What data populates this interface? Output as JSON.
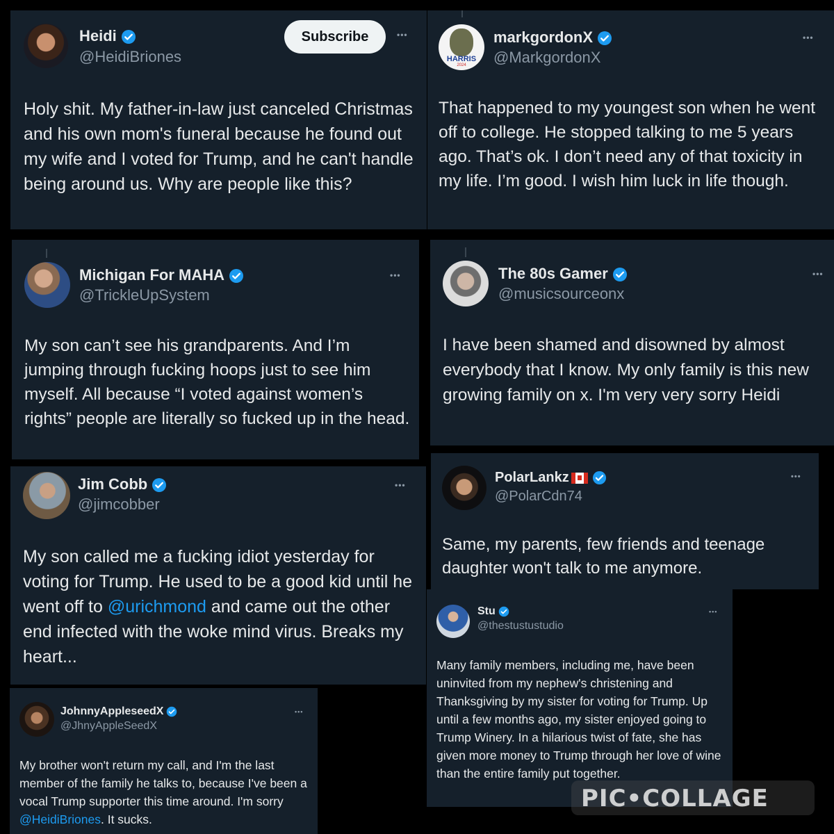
{
  "colors": {
    "background": "#000000",
    "card": "#15202b",
    "text": "#e7e9ea",
    "muted": "#8b98a5",
    "link": "#1d9bf0",
    "verified": "#1d9bf0"
  },
  "icons": {
    "verified": "verified-badge-icon",
    "more": "more-dots-icon",
    "flag": "canada-flag-icon"
  },
  "posts": [
    {
      "name": "Heidi",
      "handle": "@HeidiBriones",
      "subscribe_label": "Subscribe",
      "more": "•••",
      "text": "Holy shit. My father-in-law just canceled Christmas and his own mom's funeral because he found out my wife and I voted for Trump, and he can't handle being around us. Why are people like this?"
    },
    {
      "name": "markgordonX",
      "handle": "@MarkgordonX",
      "avatar_text": "HARRIS",
      "avatar_sub": "2024",
      "more": "•••",
      "text": "That happened to my youngest son when he went off to college. He stopped talking to me 5 years ago. That’s ok. I don’t need any of that toxicity in my life. I’m good. I wish him luck in life though."
    },
    {
      "name": "Michigan For MAHA",
      "handle": "@TrickleUpSystem",
      "more": "•••",
      "text": "My son can’t see his grandparents. And I’m jumping through fucking hoops just to see him myself. All because “I voted against women’s rights” people are literally so fucked up in the head."
    },
    {
      "name": "The 80s Gamer",
      "handle": "@musicsourceonx",
      "more": "•••",
      "text": "I have been shamed and disowned by almost everybody that I know. My only family is this new growing family on x. I'm very very sorry Heidi"
    },
    {
      "name": "Jim Cobb",
      "handle": "@jimcobber",
      "more": "•••",
      "text_before": "My son called me a fucking idiot yesterday for voting for Trump. He used to be a good kid until he went off to ",
      "mention": "@urichmond",
      "text_after": " and came out the other end infected with the woke mind virus. Breaks my heart..."
    },
    {
      "name": "PolarLankz",
      "handle": "@PolarCdn74",
      "more": "•••",
      "text": "Same, my parents, few friends and teenage daughter won't talk to me anymore."
    },
    {
      "name": "Stu",
      "handle": "@thestustustudio",
      "more": "•••",
      "text": "Many family members, including me, have been uninvited from my nephew's christening and Thanksgiving by my sister for voting for Trump. Up until a few months ago, my sister enjoyed going to Trump Winery. In a hilarious twist of fate, she has given more money to Trump through her love of wine than the entire family put together."
    },
    {
      "name": "JohnnyAppleseedX",
      "handle": "@JhnyAppleSeedX",
      "more": "•••",
      "text_before": "My brother won't return my call, and I'm the last member of the family he talks to, because I've been a vocal Trump supporter this time around. I'm sorry ",
      "mention": "@HeidiBriones",
      "text_after": ".  It sucks."
    }
  ],
  "watermark": "PIC•COLLAGE"
}
